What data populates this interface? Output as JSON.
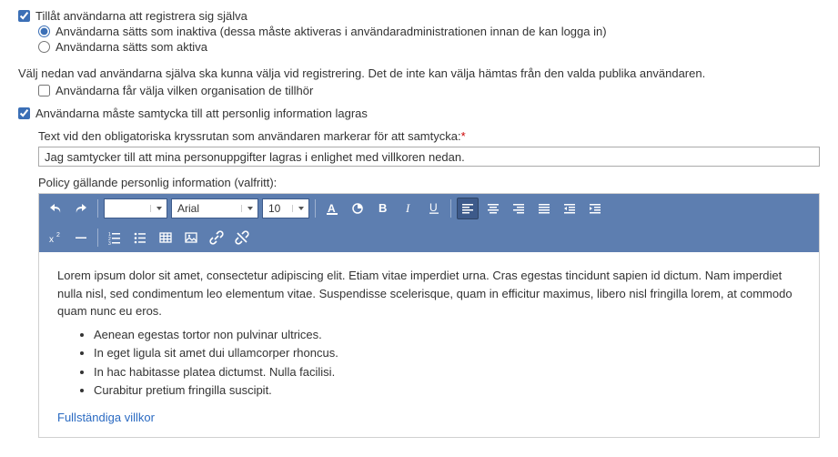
{
  "allow_self_register": {
    "label": "Tillåt användarna att registrera sig själva",
    "inactive_label": "Användarna sätts som inaktiva (dessa måste aktiveras i användaradministrationen innan de kan logga in)",
    "active_label": "Användarna sätts som aktiva"
  },
  "choose_intro": "Välj nedan vad användarna själva ska kunna välja vid registrering. Det de inte kan välja hämtas från den valda publika användaren.",
  "choose_org_label": "Användarna får välja vilken organisation de tillhör",
  "consent_required_label": "Användarna måste samtycka till att personlig information lagras",
  "consent_text_label": "Text vid den obligatoriska kryssrutan som användaren markerar för att samtycka:",
  "consent_text_value": "Jag samtycker till att mina personuppgifter lagras i enlighet med villkoren nedan.",
  "policy_label": "Policy gällande personlig information (valfritt):",
  "toolbar": {
    "font_name": "Arial",
    "font_size": "10"
  },
  "editor": {
    "para1": "Lorem ipsum dolor sit amet, consectetur adipiscing elit. Etiam vitae imperdiet urna. Cras egestas tincidunt sapien id dictum. Nam imperdiet nulla nisl, sed condimentum leo elementum vitae. Suspendisse scelerisque, quam in efficitur maximus, libero nisl fringilla lorem, at commodo quam nunc eu eros.",
    "bullets": [
      "Aenean egestas tortor non pulvinar ultrices.",
      "In eget ligula sit amet dui ullamcorper rhoncus.",
      "In hac habitasse platea dictumst. Nulla facilisi.",
      "Curabitur pretium fringilla suscipit."
    ],
    "link_text": "Fullständiga villkor"
  }
}
